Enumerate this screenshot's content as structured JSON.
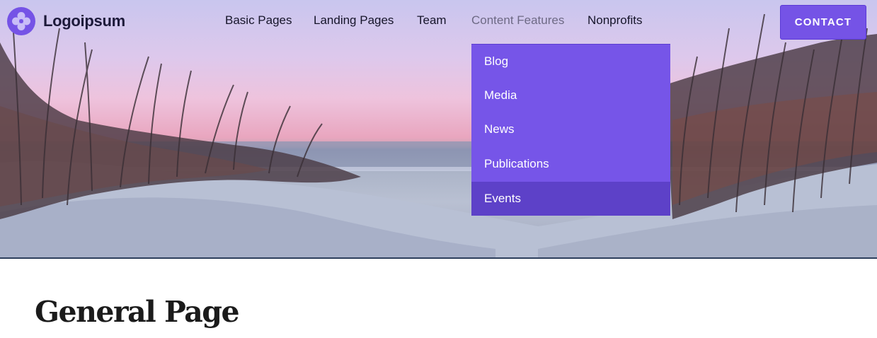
{
  "brand": {
    "name": "Logoipsum",
    "accent": "#7553e6"
  },
  "nav": {
    "items": [
      {
        "label": "Basic Pages"
      },
      {
        "label": "Landing Pages"
      },
      {
        "label": "Team"
      },
      {
        "label": "Content Features",
        "active": true
      },
      {
        "label": "Nonprofits"
      }
    ]
  },
  "contact": {
    "label": "CONTACT"
  },
  "dropdown": {
    "items": [
      {
        "label": "Blog"
      },
      {
        "label": "Media"
      },
      {
        "label": "News"
      },
      {
        "label": "Publications"
      },
      {
        "label": "Events",
        "hovered": true
      }
    ]
  },
  "page": {
    "title": "General Page"
  }
}
